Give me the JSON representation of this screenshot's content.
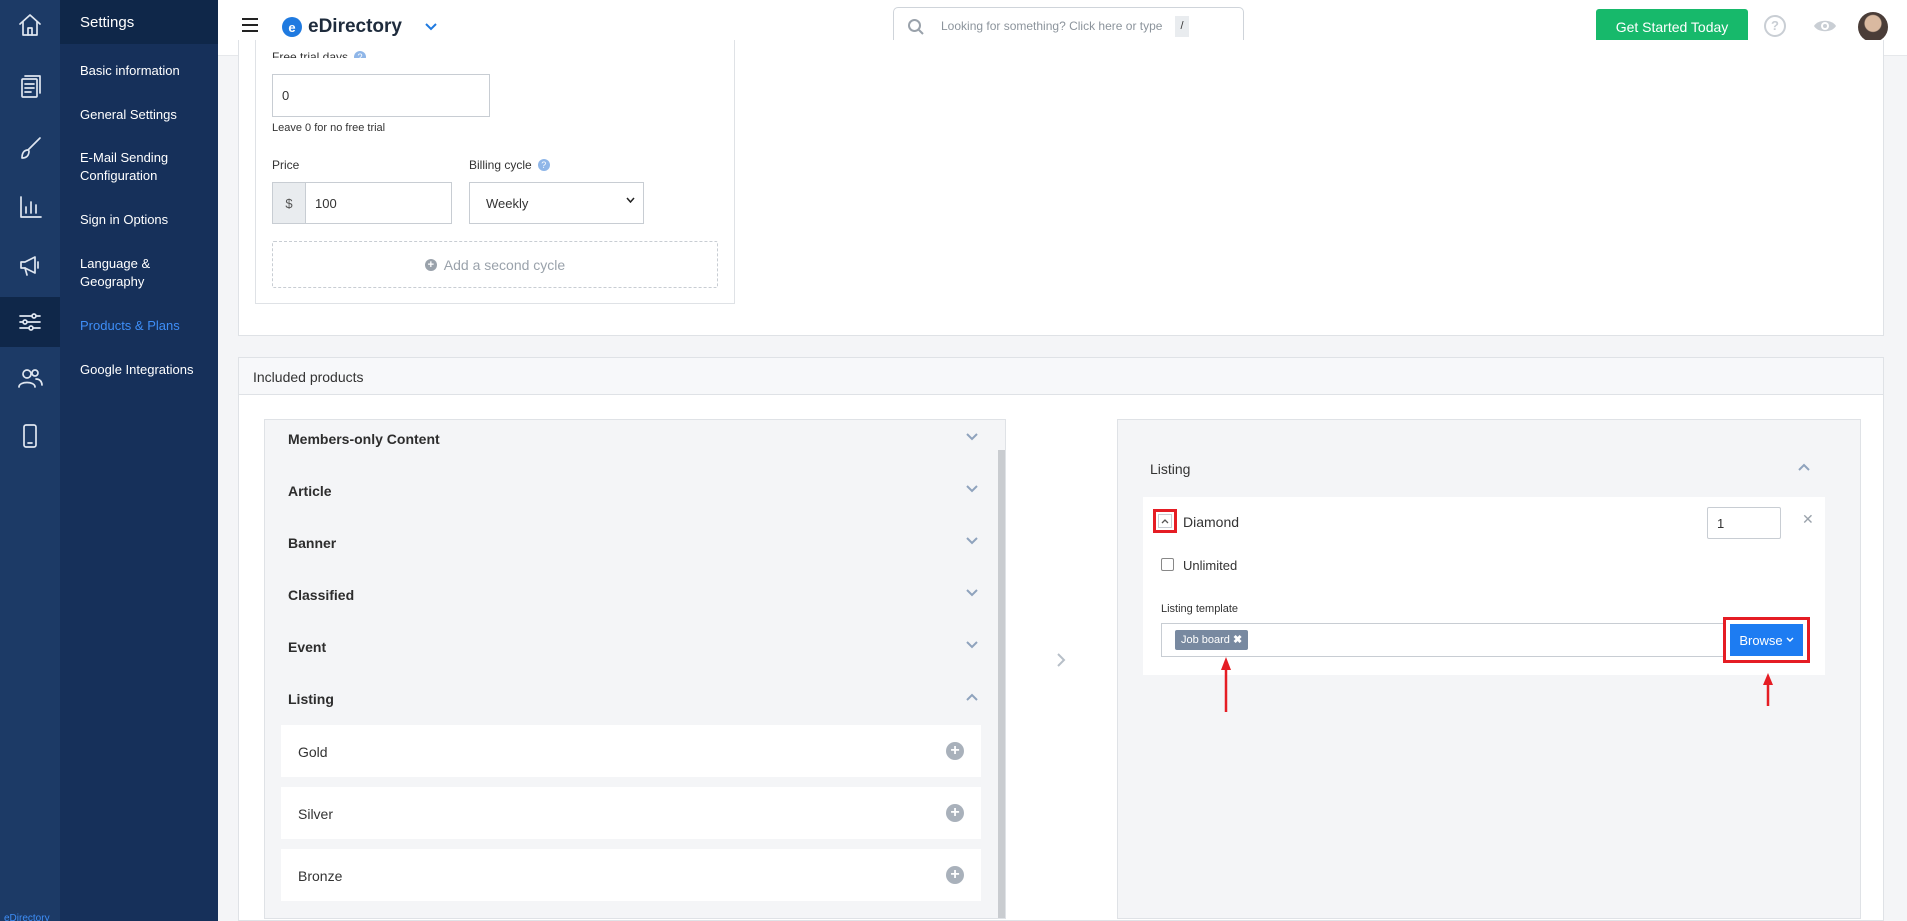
{
  "app": {
    "brand_name": "eDirectory",
    "logo_letter": "e",
    "rail_brand": "eDirectory"
  },
  "rail": {
    "items": [
      {
        "icon": "home-icon"
      },
      {
        "icon": "content-icon"
      },
      {
        "icon": "design-icon"
      },
      {
        "icon": "reports-icon"
      },
      {
        "icon": "promote-icon"
      },
      {
        "icon": "settings-sliders-icon",
        "active": true
      },
      {
        "icon": "users-icon"
      },
      {
        "icon": "mobile-icon"
      }
    ]
  },
  "menu": {
    "title": "Settings",
    "items": [
      {
        "label": "Basic information"
      },
      {
        "label": "General Settings"
      },
      {
        "label": "E-Mail Sending Configuration"
      },
      {
        "label": "Sign in Options"
      },
      {
        "label": "Language & Geography"
      },
      {
        "label": "Products & Plans",
        "active": true
      },
      {
        "label": "Google Integrations"
      }
    ]
  },
  "header": {
    "search_placeholder": "Looking for something? Click here or type",
    "search_shortcut": "/",
    "cta_label": "Get Started Today",
    "help_glyph": "?"
  },
  "plan": {
    "trial_label": "Free trial days",
    "trial_value": "0",
    "trial_hint": "Leave 0 for no free trial",
    "price_label": "Price",
    "currency_symbol": "$",
    "price_value": "100",
    "billing_label": "Billing cycle",
    "billing_value": "Weekly",
    "add_cycle_label": "Add a second cycle"
  },
  "included": {
    "title": "Included products",
    "categories": [
      {
        "label": "Members-only Content",
        "expanded": false
      },
      {
        "label": "Article",
        "expanded": false
      },
      {
        "label": "Banner",
        "expanded": false
      },
      {
        "label": "Classified",
        "expanded": false
      },
      {
        "label": "Event",
        "expanded": false
      },
      {
        "label": "Listing",
        "expanded": true
      }
    ],
    "listing_levels": [
      {
        "label": "Gold"
      },
      {
        "label": "Silver"
      },
      {
        "label": "Bronze"
      }
    ],
    "selected": {
      "category": "Listing",
      "level": "Diamond",
      "quantity": "1",
      "unlimited_label": "Unlimited",
      "unlimited_checked": false,
      "template_label": "Listing template",
      "template_tag": "Job board",
      "browse_label": "Browse"
    }
  },
  "colors": {
    "accent": "#1d7cf2",
    "cta_green": "#17b96b",
    "highlight_red": "#e51d24",
    "rail_bg": "#1c3a66"
  }
}
